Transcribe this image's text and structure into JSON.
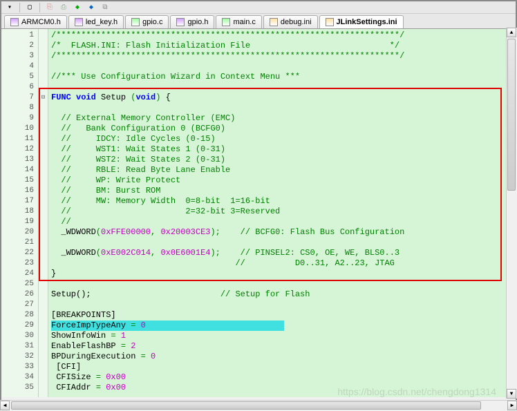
{
  "toolbar": {
    "icons": [
      "arrow-down-icon",
      "sep",
      "box-icon",
      "sep",
      "copy-icon",
      "paste-icon",
      "diamond-green-icon",
      "diamond-blue-icon",
      "tree-icon"
    ]
  },
  "tabs": [
    {
      "label": "ARMCM0.h",
      "type": "h",
      "active": false
    },
    {
      "label": "led_key.h",
      "type": "h",
      "active": false
    },
    {
      "label": "gpio.c",
      "type": "c",
      "active": false
    },
    {
      "label": "gpio.h",
      "type": "h",
      "active": false
    },
    {
      "label": "main.c",
      "type": "c",
      "active": false
    },
    {
      "label": "debug.ini",
      "type": "ini",
      "active": false
    },
    {
      "label": "JLinkSettings.ini",
      "type": "ini",
      "active": true
    }
  ],
  "code": {
    "lines": [
      {
        "n": 1,
        "t": "comment",
        "text": "/*********************************************************************/"
      },
      {
        "n": 2,
        "t": "comment",
        "text": "/*  FLASH.INI: Flash Initialization File                            */"
      },
      {
        "n": 3,
        "t": "comment",
        "text": "/*********************************************************************/"
      },
      {
        "n": 4,
        "t": "blank",
        "text": ""
      },
      {
        "n": 5,
        "t": "comment",
        "text": "//*** Use Configuration Wizard in Context Menu ***"
      },
      {
        "n": 6,
        "t": "blank",
        "text": ""
      },
      {
        "n": 7,
        "t": "func",
        "fold": "minus",
        "kw1": "FUNC",
        "kw2": "void",
        "name": "Setup",
        "kw3": "void",
        "brace": "{"
      },
      {
        "n": 8,
        "t": "blank",
        "text": ""
      },
      {
        "n": 9,
        "t": "comment",
        "text": "  // External Memory Controller (EMC)"
      },
      {
        "n": 10,
        "t": "comment",
        "text": "  //   Bank Configuration 0 (BCFG0)"
      },
      {
        "n": 11,
        "t": "comment",
        "text": "  //     IDCY: Idle Cycles (0-15)"
      },
      {
        "n": 12,
        "t": "comment",
        "text": "  //     WST1: Wait States 1 (0-31)"
      },
      {
        "n": 13,
        "t": "comment",
        "text": "  //     WST2: Wait States 2 (0-31)"
      },
      {
        "n": 14,
        "t": "comment",
        "text": "  //     RBLE: Read Byte Lane Enable"
      },
      {
        "n": 15,
        "t": "comment",
        "text": "  //     WP: Write Protect"
      },
      {
        "n": 16,
        "t": "comment",
        "text": "  //     BM: Burst ROM"
      },
      {
        "n": 17,
        "t": "comment",
        "text": "  //     MW: Memory Width  0=8-bit  1=16-bit"
      },
      {
        "n": 18,
        "t": "comment",
        "text": "  //                       2=32-bit 3=Reserved"
      },
      {
        "n": 19,
        "t": "comment",
        "text": "  //"
      },
      {
        "n": 20,
        "t": "call",
        "func": "_WDWORD",
        "a1": "0xFFE00000",
        "a2": "0x20003CE3",
        "cmt": "// BCFG0: Flash Bus Configuration"
      },
      {
        "n": 21,
        "t": "blank",
        "text": ""
      },
      {
        "n": 22,
        "t": "call",
        "func": "_WDWORD",
        "a1": "0xE002C014",
        "a2": "0x0E6001E4",
        "cmt": "// PINSEL2: CS0, OE, WE, BLS0..3"
      },
      {
        "n": 23,
        "t": "comment",
        "text": "                                     //          D0..31, A2..23, JTAG"
      },
      {
        "n": 24,
        "t": "plain",
        "text": "}"
      },
      {
        "n": 25,
        "t": "blank",
        "text": ""
      },
      {
        "n": 26,
        "t": "setup",
        "text": "Setup();",
        "cmt": "// Setup for Flash"
      },
      {
        "n": 27,
        "t": "blank",
        "text": ""
      },
      {
        "n": 28,
        "t": "section",
        "text": "[BREAKPOINTS]"
      },
      {
        "n": 29,
        "t": "assign",
        "hl": true,
        "lhs": "ForceImpTypeAny",
        "val": "0"
      },
      {
        "n": 30,
        "t": "assign",
        "lhs": "ShowInfoWin",
        "val": "1"
      },
      {
        "n": 31,
        "t": "assign",
        "lhs": "EnableFlashBP",
        "val": "2"
      },
      {
        "n": 32,
        "t": "assign",
        "lhs": "BPDuringExecution",
        "val": "0"
      },
      {
        "n": 33,
        "t": "section",
        "text": " [CFI]"
      },
      {
        "n": 34,
        "t": "assign",
        "lhs": " CFISize",
        "val": "0x00"
      },
      {
        "n": 35,
        "t": "assign",
        "lhs": " CFIAddr",
        "val": "0x00"
      }
    ]
  },
  "watermark": "https://blog.csdn.net/chengdong1314"
}
